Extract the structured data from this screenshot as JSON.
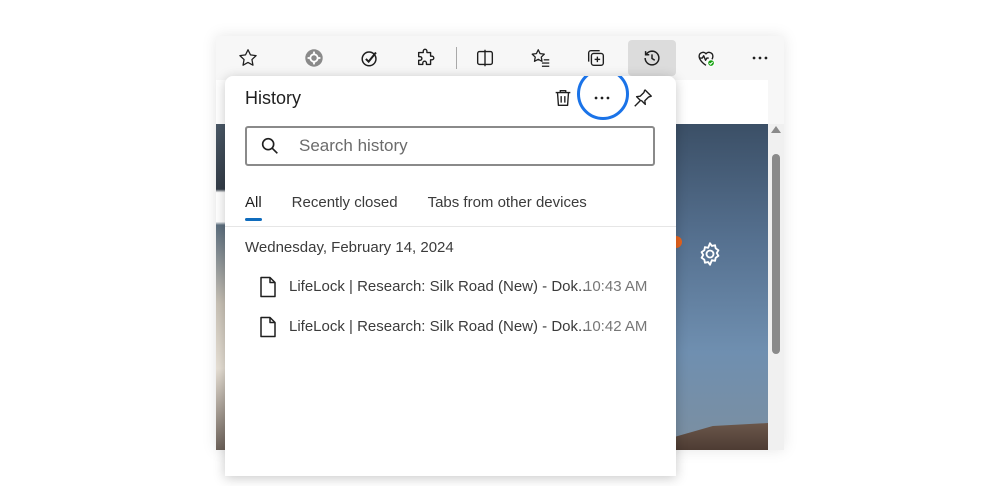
{
  "toolbar": {
    "buttons": [
      {
        "name": "favorite-star-icon",
        "label": "Add to favorites"
      },
      {
        "name": "extension-gear-icon",
        "label": "Extension"
      },
      {
        "name": "extension-check-icon",
        "label": "Extension"
      },
      {
        "name": "extensions-puzzle-icon",
        "label": "Extensions"
      },
      {
        "name": "split-screen-icon",
        "label": "Split screen"
      },
      {
        "name": "favorites-list-icon",
        "label": "Favorites"
      },
      {
        "name": "collections-icon",
        "label": "Collections"
      },
      {
        "name": "history-icon",
        "label": "History"
      },
      {
        "name": "browser-essentials-icon",
        "label": "Browser essentials"
      },
      {
        "name": "more-options-icon",
        "label": "Settings and more"
      }
    ],
    "active": "history-icon"
  },
  "history_panel": {
    "title": "History",
    "search": {
      "placeholder": "Search history",
      "value": ""
    },
    "tabs": [
      {
        "label": "All",
        "active": true
      },
      {
        "label": "Recently closed",
        "active": false
      },
      {
        "label": "Tabs from other devices",
        "active": false
      }
    ],
    "date_heading": "Wednesday, February 14, 2024",
    "items": [
      {
        "title": "LifeLock | Research: Silk Road (New) - Dok...",
        "time": "10:43 AM"
      },
      {
        "title": "LifeLock | Research: Silk Road (New) - Dok...",
        "time": "10:42 AM"
      }
    ]
  },
  "colors": {
    "accent": "#0f6cbd",
    "highlight_ring": "#1a73e8",
    "status_badge": "#13a10e"
  }
}
